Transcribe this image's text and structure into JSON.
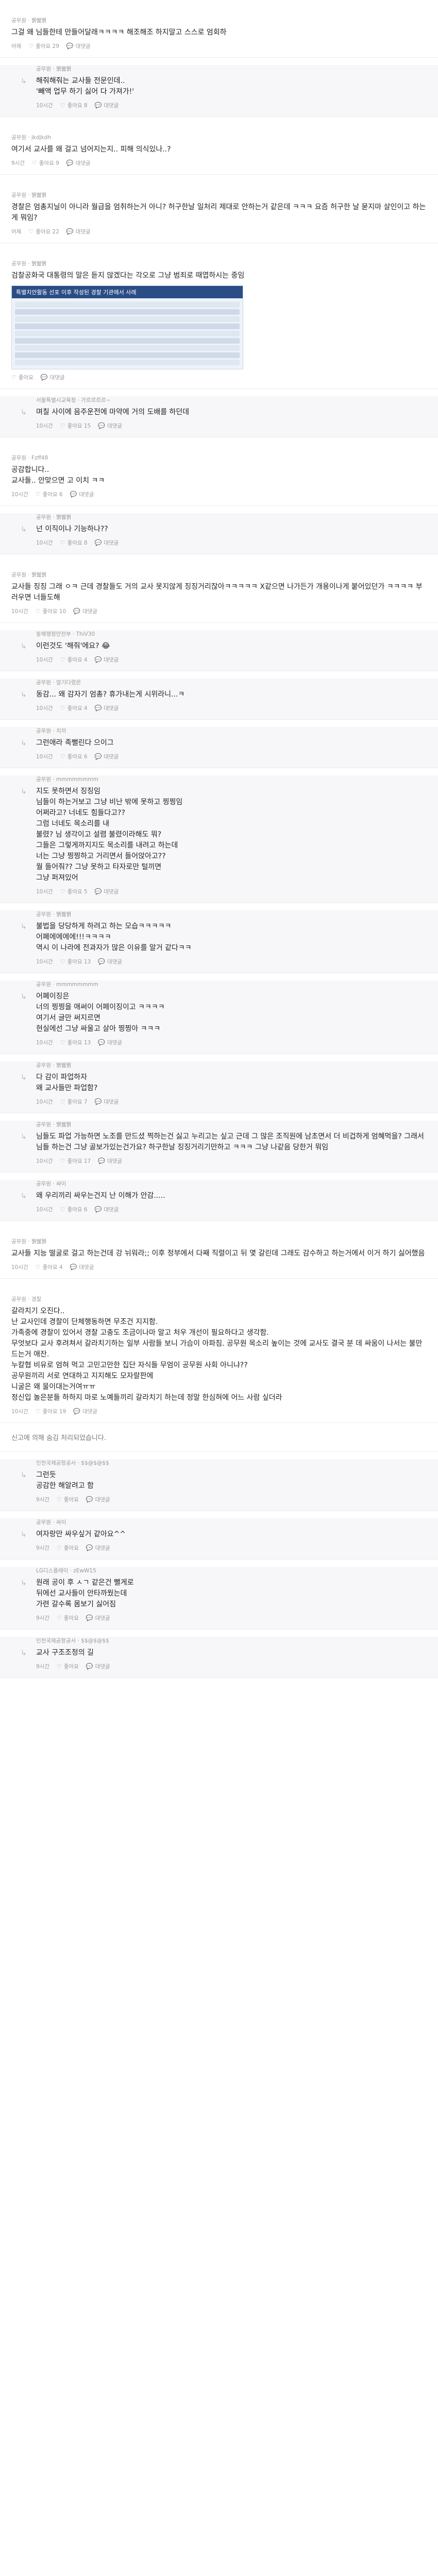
{
  "labels": {
    "like": "좋아요",
    "reply": "대댓글",
    "time_ago_10": "10시간",
    "time_ago_9": "9시간"
  },
  "notice": "신고에 의해 숨김 처리되었습니다.",
  "infographic": {
    "title": "특별치안활동 선포 이후 작성된 경찰 기관에서 사례"
  },
  "comments": [
    {
      "type": "top",
      "nick": "공무원 · 뷁쒧뷁",
      "text": "그걸 왜 님들한테 만들어달래ㅋㅋㅋㅋ 해조해조 하지말고 스스로 엄회하",
      "time": "어제",
      "likes": "좋아요 29"
    },
    {
      "type": "reply",
      "nick": "공무원 · 뷁쒧뷁",
      "text": "해줘해줘는 교사들 전문인데..\n'빼액 업무 하기 싫어 다 가져가!'",
      "time": "10시간",
      "likes": "좋아요 8"
    },
    {
      "type": "top",
      "nick": "공무원 · jkdjkdh",
      "text": "여기서 교사를 왜 걸고 넘어지는지.. 피해 의식있나..?",
      "time": "9시간",
      "likes": "좋아요 9"
    },
    {
      "type": "top",
      "nick": "공무원 · 뷁쒧뷁",
      "text": "경찰은 엄총지닐이 아니라 월급을 엄취하는거 아니? 허구한날 일처리 제대로 안하는거 같은데 ㅋㅋㅋ 요즘 허구한 날 묻지마 살인이고 하는게 뭐임?",
      "time": "어제",
      "likes": "좋아요 22"
    },
    {
      "type": "top",
      "nick": "공무원 · 뷁쒧뷁",
      "text": "검찰공화국 대통령의 말은 듣지 않겠다는 각오로 그냥 범죄로 때엽하시는 중임",
      "time": "",
      "likes": "",
      "image": true
    },
    {
      "type": "reply",
      "nick": "서울특별시교육청 · 가르르르르~",
      "text": "며칠 사이에 음주운전에 마약에 거의 도배를 하던데",
      "time": "10시간",
      "likes": "좋아요 15"
    },
    {
      "type": "top",
      "nick": "공무원 · Fzff48",
      "text": "공감합니다..\n교사들.. 안맞으면 고 이치 ㅋㅋ",
      "time": "10시간",
      "likes": "좋아요 6"
    },
    {
      "type": "reply",
      "nick": "공무원 · 뷁쒧뷁",
      "text": "넌 이직이나 기능하나??",
      "time": "10시간",
      "likes": "좋아요 8"
    },
    {
      "type": "top",
      "nick": "공무원 · 뷁쒧뷁",
      "text": "교사들 징징 그래 ㅇㅋ 근데 경찰들도 거의 교사 못지않게 징징거리잖아ㅋㅋㅋㅋㅋ X같으면 나가든가 개용이나게 붙어있던가 ㅋㅋㅋㅋ 부러우면 너들도해",
      "time": "10시간",
      "likes": "좋아요 10"
    },
    {
      "type": "reply",
      "nick": "동해행정안전부 · ThiV30",
      "text": "이런것도 '해줘'에요? 😂",
      "time": "10시간",
      "likes": "좋아요 4"
    },
    {
      "type": "reply",
      "nick": "공무원 · 알기다렸온",
      "text": "동감... 왜 감자기 엄총? 휴가내는게 시위라니...ㅋ",
      "time": "10시간",
      "likes": "좋아요 4"
    },
    {
      "type": "reply",
      "nick": "공무원 · 치끼",
      "text": "그런애라 족뻘린다 으이그",
      "time": "10시간",
      "likes": "좋아요 6"
    },
    {
      "type": "reply",
      "nick": "공무원 · mmmmmmmm",
      "text": "지도 못하면서 징징임\n님들이 하는거보고 그냥 비난 밖에 못하고 찡찡임\n어쩌라고? 너네도 힘들다고??\n그럼 너네도 목소리를 내\n불렸? 님 생각이고 설렴 불렸이라해도 뭐?\n그들은 그렇게까지지도 목소리를 내려고 하는데\n너는 그냥 찡찡하고 거리면서 들어앉아고??\n월 들어줘?? 그냥 못하고 타자로만 털끼면\n그냥 퍼져있어",
      "time": "10시간",
      "likes": "좋아요 5"
    },
    {
      "type": "reply",
      "nick": "공무원 · 뷁쒧뷁",
      "text": "불법을 당당하게 하려고 하는 모습ㅋㅋㅋㅋㅋ\n어폐에에에에!!!ㅋㅋㅋㅋ\n역시 이 나라에 전과자가 많은 이유를 알거 같다ㅋㅋ",
      "time": "10시간",
      "likes": "좋아요 13"
    },
    {
      "type": "reply",
      "nick": "공무원 · mmmmmmmm",
      "text": "어폐이징은\n너의 찡찡을 애써이 어페이징이고 ㅋㅋㅋㅋ\n여기서 글만 써지르면\n현실에선 그냥 싸울고 살아 찡찡아 ㅋㅋㅋ",
      "time": "10시간",
      "likes": "좋아요 13"
    },
    {
      "type": "reply",
      "nick": "공무원 · 뷁쒧뷁",
      "text": "다 감이 파업하자\n왜 교사들만 파업함?",
      "time": "10시간",
      "likes": "좋아요 7"
    },
    {
      "type": "reply",
      "nick": "공무원 · 뷁쒧뷁",
      "text": "님들도 파업 가능하면 노조를 만드셨 찍하는건 싫고 누리고는 싶고 근데 그 많은 조직원에 남초면서 더 비겁하게 엄혜먹을? 그래서 님들 하는건 그냥 골보가있는건가요? 하구한날 징징거리기만하고 ㅋㅋㅋ 그냥 나같음 당한거 뭐임",
      "time": "10시간",
      "likes": "좋아요 17"
    },
    {
      "type": "reply",
      "nick": "공무원 · 싸이",
      "text": "왜 우리끼리 싸우는건지 난 이해가 안감.....",
      "time": "10시간",
      "likes": "좋아요 6"
    },
    {
      "type": "top",
      "nick": "공무원 · 뷁쒧뷁",
      "text": "교사들 지능 떨굴로 걸고 하는건데 강 뉘워라;; 이후 정부에서 다째 직렬이고 뒤 몇 갈린데 그래도 감수하고 하는거에서 이거 하기 싫어했음",
      "time": "10시간",
      "likes": "좋아요 4"
    },
    {
      "type": "top",
      "nick": "공무원 · 경찰",
      "text": "갈라치기 오진다..\n난 교사인데 경찰이 단체행동하면 무조건 지지함.\n가족중에 경찰이 있어서 경찰 고충도 조금이나마 알고 처우 개선이 필요하다고 생각함.\n무엇보다 교사 후려쳐서 갈라치기하는 일부 사람들 보니 가슴이 아파짐. 공무원 목소리 높이는 것에 교사도 결국 분 데 싸움이 나서는 불만드는거 애잔.\n누칼협 비유로 엄혀 먹고 고민고만한 집단 자식들 무엄이 공무원 사회 아니냐??\n공무원끼리 서로 연대하고 지지해도 모자랄판에\n니굴은 왜 물이대는거여ㅠㅠ\n정신입 놀은분들 하하지 마로 노예들끼리 갈라치기 하는데 정말 한심혀에 어느 사람 싶더라",
      "time": "10시간",
      "likes": "좋아요 19"
    },
    {
      "type": "reply",
      "nick": "인천국제공항공사 · $$@$@$$",
      "text": "그런듯\n공감한 해알려고 함",
      "time": "9시간",
      "likes": "좋아요"
    },
    {
      "type": "reply",
      "nick": "공무원 · 싸이",
      "text": "여자랑만 싸우싶거 같아요^^",
      "time": "9시간",
      "likes": "좋아요"
    },
    {
      "type": "reply",
      "nick": "LG디스플레이 · zEwW15",
      "text": "원래 공이 후 ㅅㄱ 같은건 뻘게로\n뒤에선 교사들이 안타까웠는데\n가련 갈수록 몸보기 싫어짐",
      "time": "9시간",
      "likes": "좋아요"
    },
    {
      "type": "reply",
      "nick": "인천국제공항공사 · $$@$@$$",
      "text": "교사 구조조정의 길",
      "time": "9시간",
      "likes": "좋아요"
    }
  ]
}
